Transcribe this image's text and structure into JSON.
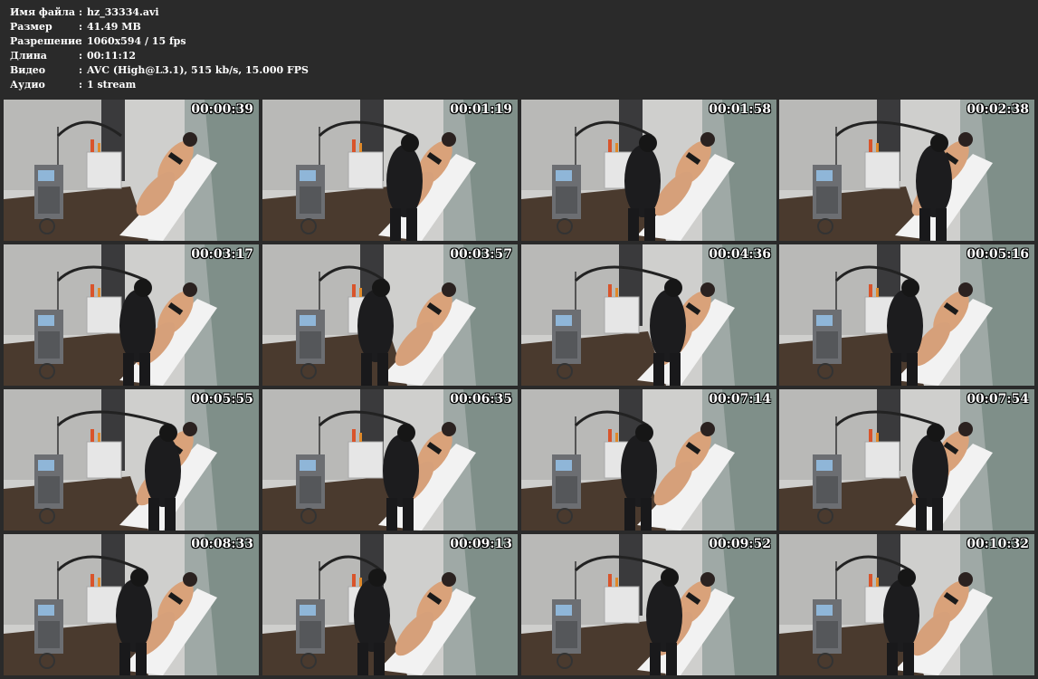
{
  "file_info": [
    {
      "label": "Имя файла",
      "value": "hz_33334.avi"
    },
    {
      "label": "Размер",
      "value": "41.49 MB"
    },
    {
      "label": "Разрешение",
      "value": "1060x594 / 15 fps"
    },
    {
      "label": "Длина",
      "value": "00:11:12"
    },
    {
      "label": "Видео",
      "value": "AVC (High@L3.1), 515 kb/s, 15.000 FPS"
    },
    {
      "label": "Аудио",
      "value": "1 stream"
    }
  ],
  "separator": ":",
  "thumbnails": [
    {
      "timestamp": "00:00:39"
    },
    {
      "timestamp": "00:01:19"
    },
    {
      "timestamp": "00:01:58"
    },
    {
      "timestamp": "00:02:38"
    },
    {
      "timestamp": "00:03:17"
    },
    {
      "timestamp": "00:03:57"
    },
    {
      "timestamp": "00:04:36"
    },
    {
      "timestamp": "00:05:16"
    },
    {
      "timestamp": "00:05:55"
    },
    {
      "timestamp": "00:06:35"
    },
    {
      "timestamp": "00:07:14"
    },
    {
      "timestamp": "00:07:54"
    },
    {
      "timestamp": "00:08:33"
    },
    {
      "timestamp": "00:09:13"
    },
    {
      "timestamp": "00:09:52"
    },
    {
      "timestamp": "00:10:32"
    }
  ],
  "colors": {
    "background": "#2a2a2a",
    "text": "#ffffff"
  }
}
